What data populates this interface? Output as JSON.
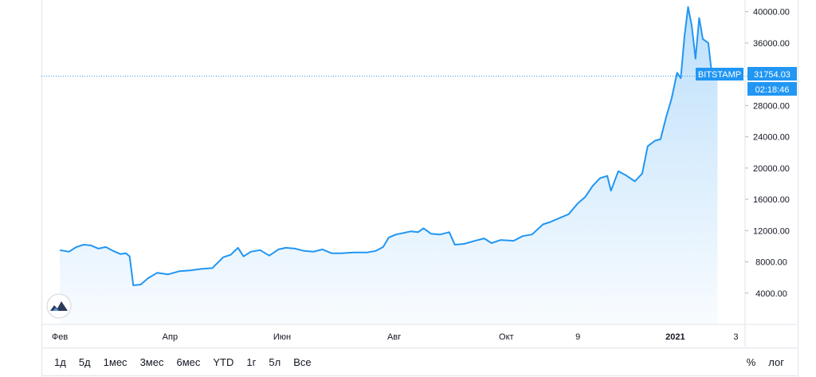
{
  "chart_data": {
    "type": "area",
    "exchange_label": "BITSTAMP",
    "last_price": "31754.03",
    "countdown": "02:18:46",
    "color": "#2196f3",
    "ylim": [
      0,
      41500
    ],
    "y_ticks": [
      "4000.00",
      "8000.00",
      "12000.00",
      "16000.00",
      "20000.00",
      "24000.00",
      "28000.00",
      "32000.00",
      "36000.00",
      "40000.00"
    ],
    "x_ticks": [
      {
        "label": "Фев",
        "x": "2020-02-01"
      },
      {
        "label": "Апр",
        "x": "2020-04-01"
      },
      {
        "label": "Июн",
        "x": "2020-06-01"
      },
      {
        "label": "Авг",
        "x": "2020-08-01"
      },
      {
        "label": "Окт",
        "x": "2020-10-01"
      },
      {
        "label": "9",
        "x": "2020-11-09"
      },
      {
        "label": "2021",
        "x": "2021-01-01"
      },
      {
        "label": "3",
        "x": "2021-02-03"
      }
    ],
    "series": [
      {
        "points": [
          [
            "2020-02-01",
            9500
          ],
          [
            "2020-02-06",
            9300
          ],
          [
            "2020-02-10",
            9900
          ],
          [
            "2020-02-14",
            10200
          ],
          [
            "2020-02-18",
            10100
          ],
          [
            "2020-02-22",
            9700
          ],
          [
            "2020-02-26",
            9900
          ],
          [
            "2020-03-01",
            9400
          ],
          [
            "2020-03-05",
            9000
          ],
          [
            "2020-03-08",
            9100
          ],
          [
            "2020-03-10",
            8700
          ],
          [
            "2020-03-12",
            5000
          ],
          [
            "2020-03-16",
            5100
          ],
          [
            "2020-03-20",
            5900
          ],
          [
            "2020-03-25",
            6600
          ],
          [
            "2020-03-31",
            6400
          ],
          [
            "2020-04-06",
            6800
          ],
          [
            "2020-04-12",
            6900
          ],
          [
            "2020-04-18",
            7100
          ],
          [
            "2020-04-24",
            7200
          ],
          [
            "2020-04-30",
            8600
          ],
          [
            "2020-05-04",
            8900
          ],
          [
            "2020-05-08",
            9800
          ],
          [
            "2020-05-11",
            8700
          ],
          [
            "2020-05-15",
            9300
          ],
          [
            "2020-05-20",
            9500
          ],
          [
            "2020-05-25",
            8800
          ],
          [
            "2020-05-30",
            9600
          ],
          [
            "2020-06-03",
            9800
          ],
          [
            "2020-06-08",
            9700
          ],
          [
            "2020-06-13",
            9400
          ],
          [
            "2020-06-18",
            9300
          ],
          [
            "2020-06-23",
            9600
          ],
          [
            "2020-06-28",
            9100
          ],
          [
            "2020-07-03",
            9100
          ],
          [
            "2020-07-10",
            9200
          ],
          [
            "2020-07-17",
            9200
          ],
          [
            "2020-07-22",
            9400
          ],
          [
            "2020-07-26",
            9900
          ],
          [
            "2020-07-29",
            11100
          ],
          [
            "2020-08-02",
            11500
          ],
          [
            "2020-08-06",
            11700
          ],
          [
            "2020-08-10",
            11900
          ],
          [
            "2020-08-14",
            11800
          ],
          [
            "2020-08-17",
            12300
          ],
          [
            "2020-08-21",
            11600
          ],
          [
            "2020-08-26",
            11500
          ],
          [
            "2020-08-31",
            11800
          ],
          [
            "2020-09-03",
            10200
          ],
          [
            "2020-09-08",
            10300
          ],
          [
            "2020-09-14",
            10700
          ],
          [
            "2020-09-19",
            11000
          ],
          [
            "2020-09-23",
            10400
          ],
          [
            "2020-09-28",
            10800
          ],
          [
            "2020-10-05",
            10700
          ],
          [
            "2020-10-10",
            11300
          ],
          [
            "2020-10-15",
            11500
          ],
          [
            "2020-10-21",
            12800
          ],
          [
            "2020-10-25",
            13100
          ],
          [
            "2020-10-30",
            13600
          ],
          [
            "2020-11-04",
            14100
          ],
          [
            "2020-11-09",
            15500
          ],
          [
            "2020-11-13",
            16300
          ],
          [
            "2020-11-17",
            17700
          ],
          [
            "2020-11-21",
            18700
          ],
          [
            "2020-11-25",
            19000
          ],
          [
            "2020-11-27",
            17100
          ],
          [
            "2020-12-01",
            19600
          ],
          [
            "2020-12-05",
            19100
          ],
          [
            "2020-12-10",
            18300
          ],
          [
            "2020-12-14",
            19300
          ],
          [
            "2020-12-17",
            22800
          ],
          [
            "2020-12-21",
            23500
          ],
          [
            "2020-12-24",
            23700
          ],
          [
            "2020-12-27",
            26500
          ],
          [
            "2020-12-30",
            28900
          ],
          [
            "2021-01-02",
            32200
          ],
          [
            "2021-01-04",
            31500
          ],
          [
            "2021-01-06",
            36800
          ],
          [
            "2021-01-08",
            40600
          ],
          [
            "2021-01-10",
            38200
          ],
          [
            "2021-01-12",
            34000
          ],
          [
            "2021-01-14",
            39200
          ],
          [
            "2021-01-16",
            36500
          ],
          [
            "2021-01-19",
            36000
          ],
          [
            "2021-01-21",
            31800
          ],
          [
            "2021-01-23",
            32300
          ],
          [
            "2021-01-24",
            31754
          ]
        ]
      }
    ]
  },
  "range_buttons": [
    "1д",
    "5д",
    "1мес",
    "3мес",
    "6мес",
    "YTD",
    "1г",
    "5л",
    "Все"
  ],
  "tools": {
    "percent": "%",
    "log": "лог"
  }
}
